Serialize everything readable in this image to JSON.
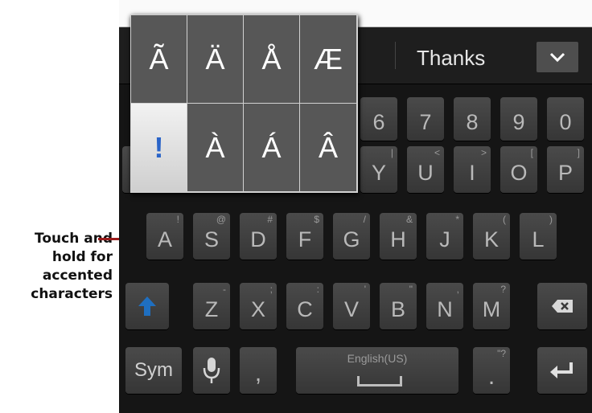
{
  "callout": {
    "line1": "Touch and",
    "line2": "hold for",
    "line3": "accented",
    "line4": "characters"
  },
  "suggestion": {
    "word": "Thanks",
    "expand_icon": "chevron-down-icon"
  },
  "popup": {
    "row1": [
      "Ã",
      "Ä",
      "Å",
      "Æ"
    ],
    "row2": [
      "!",
      "À",
      "Á",
      "Â"
    ]
  },
  "rows": {
    "numbers": [
      {
        "label": "6"
      },
      {
        "label": "7"
      },
      {
        "label": "8"
      },
      {
        "label": "9"
      },
      {
        "label": "0"
      }
    ],
    "qwerty": [
      {
        "label": "Y",
        "hint": "|"
      },
      {
        "label": "U",
        "hint": "<"
      },
      {
        "label": "I",
        "hint": ">"
      },
      {
        "label": "O",
        "hint": "["
      },
      {
        "label": "P",
        "hint": "]"
      }
    ],
    "asdf": [
      {
        "label": "A",
        "hint": "!"
      },
      {
        "label": "S",
        "hint": "@"
      },
      {
        "label": "D",
        "hint": "#"
      },
      {
        "label": "F",
        "hint": "$"
      },
      {
        "label": "G",
        "hint": "/"
      },
      {
        "label": "H",
        "hint": "&"
      },
      {
        "label": "J",
        "hint": "*"
      },
      {
        "label": "K",
        "hint": "("
      },
      {
        "label": "L",
        "hint": ")"
      }
    ],
    "zxcv": [
      {
        "label": "Z",
        "hint": "-"
      },
      {
        "label": "X",
        "hint": ";"
      },
      {
        "label": "C",
        "hint": ":"
      },
      {
        "label": "V",
        "hint": "'"
      },
      {
        "label": "B",
        "hint": "\""
      },
      {
        "label": "N",
        "hint": ","
      },
      {
        "label": "M",
        "hint": "?"
      }
    ]
  },
  "bottom": {
    "sym": "Sym",
    "comma": ",",
    "space": "English(US)",
    "period": ".",
    "period_hint": "\"?",
    "mic_icon": "microphone-icon",
    "enter_icon": "enter-icon"
  },
  "icons": {
    "shift": "shift-arrow-icon",
    "backspace": "backspace-icon"
  },
  "colors": {
    "accent": "#1f6fc0",
    "callout_line": "#9b1b1b"
  }
}
